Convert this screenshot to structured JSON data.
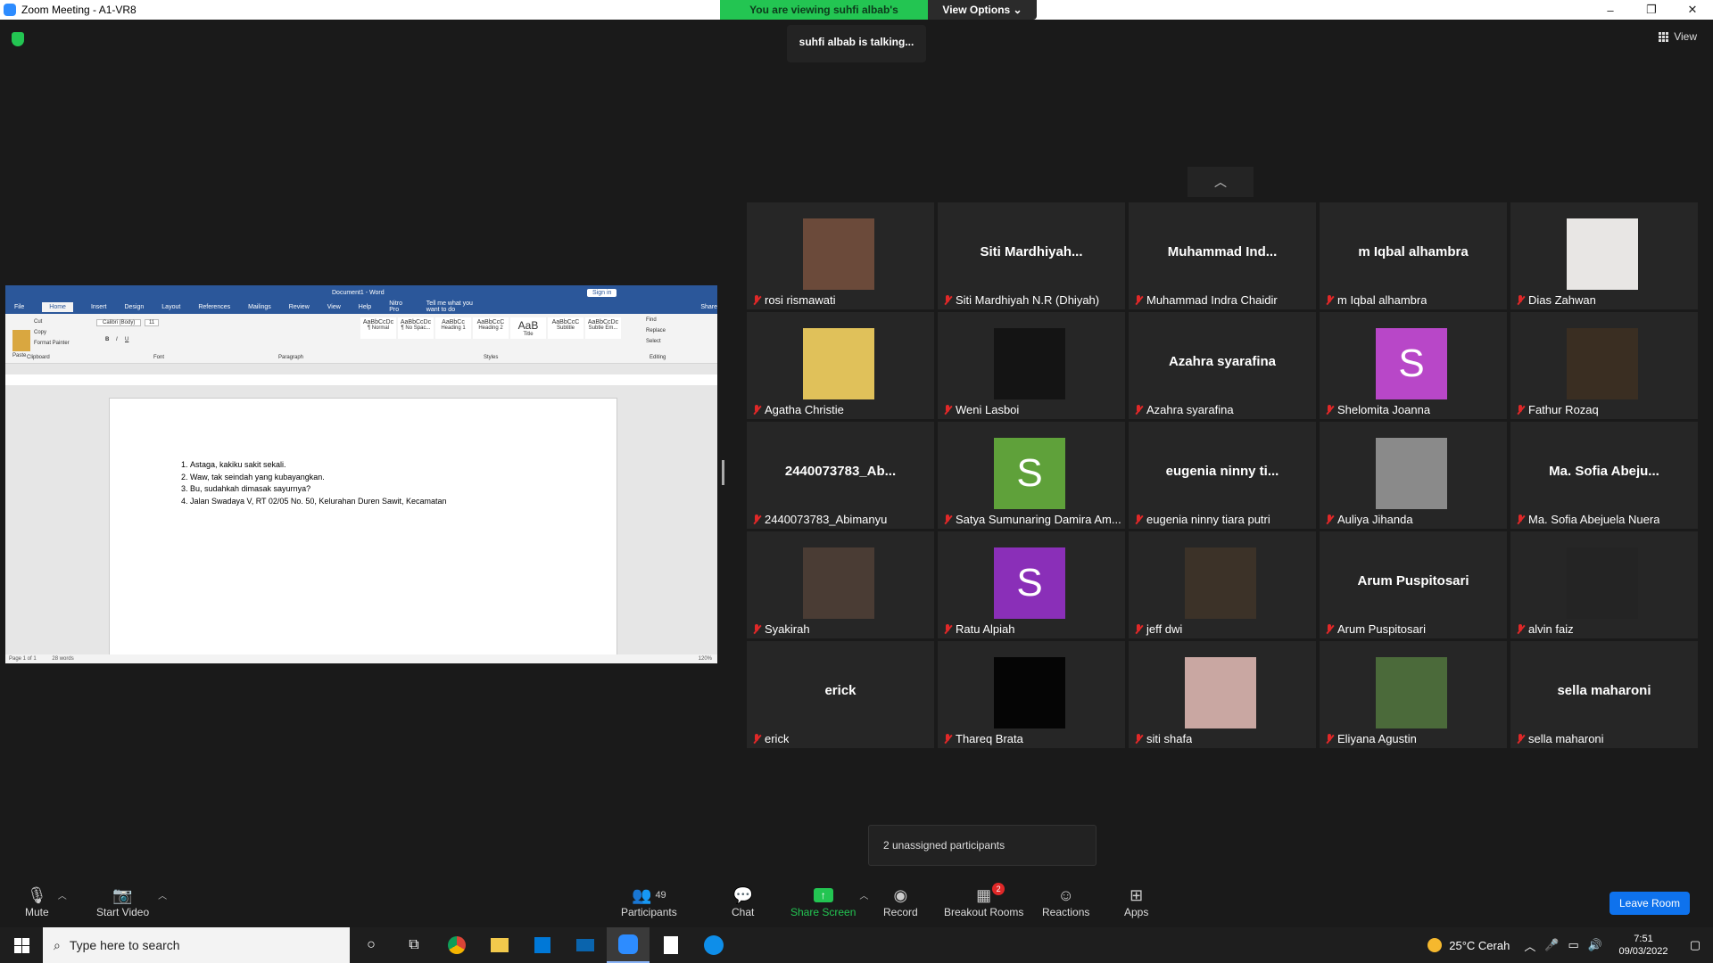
{
  "window": {
    "title": "Zoom Meeting - A1-VR8",
    "minimize": "–",
    "maximize": "❐",
    "close": "✕"
  },
  "share_banner": {
    "status": "You are viewing suhfi albab's screen",
    "view_options": "View Options ⌄"
  },
  "talking": "suhfi albab is talking...",
  "view_button": "View",
  "word": {
    "title": "Document1 - Word",
    "sign_in": "Sign in",
    "tabs": [
      "File",
      "Home",
      "Insert",
      "Design",
      "Layout",
      "References",
      "Mailings",
      "Review",
      "View",
      "Help",
      "Nitro Pro"
    ],
    "tell_me": "Tell me what you want to do",
    "share": "Share",
    "ribbon": {
      "paste": "Paste",
      "cut": "Cut",
      "copy": "Copy",
      "format_painter": "Format Painter",
      "clipboard": "Clipboard",
      "font_name": "Calibri (Body)",
      "font_size": "11",
      "font_group": "Font",
      "paragraph_group": "Paragraph",
      "styles": [
        "AaBbCcDc",
        "AaBbCcDc",
        "AaBbCc",
        "AaBbCcC",
        "AaB",
        "AaBbCcC",
        "AaBbCcDc"
      ],
      "style_names": [
        "¶ Normal",
        "¶ No Spac...",
        "Heading 1",
        "Heading 2",
        "Title",
        "Subtitle",
        "Subtle Em..."
      ],
      "styles_group": "Styles",
      "find": "Find",
      "replace": "Replace",
      "select": "Select",
      "editing_group": "Editing"
    },
    "list_items": [
      "Astaga, kakiku sakit sekali.",
      "Waw, tak seindah yang kubayangkan.",
      "Bu, sudahkah dimasak sayurnya?",
      "Jalan Swadaya V, RT 02/05 No. 50, Kelurahan Duren Sawit, Kecamatan"
    ],
    "status_page": "Page 1 of 1",
    "status_words": "28 words",
    "zoom": "120%"
  },
  "participants_grid": [
    {
      "name": "rosi rismawati",
      "video": "photo",
      "color": "#6b4a3a"
    },
    {
      "name": "Siti Mardhiyah N.R (Dhiyah)",
      "display": "Siti  Mardhiyah..."
    },
    {
      "name": "Muhammad Indra Chaidir",
      "display": "Muhammad  Ind..."
    },
    {
      "name": "m Iqbal alhambra",
      "display": "m Iqbal alhambra"
    },
    {
      "name": "Dias Zahwan",
      "video": "photo",
      "color": "#e8e6e4"
    },
    {
      "name": "Agatha Christie",
      "video": "photo",
      "color": "#e0c15a"
    },
    {
      "name": "Weni Lasboi",
      "video": "photo",
      "color": "#141414"
    },
    {
      "name": "Azahra syarafina",
      "display": "Azahra syarafina"
    },
    {
      "name": "Shelomita Joanna",
      "avatar": "S",
      "color": "#b847c8"
    },
    {
      "name": "Fathur Rozaq",
      "video": "photo",
      "color": "#3a2e22"
    },
    {
      "name": "2440073783_Abimanyu",
      "display": "2440073783_Ab..."
    },
    {
      "name": "Satya Sumunaring Damira Am...",
      "avatar": "S",
      "color": "#5fa13a"
    },
    {
      "name": "eugenia ninny tiara putri",
      "display": "eugenia  ninny  ti..."
    },
    {
      "name": "Auliya Jihanda",
      "video": "photo",
      "color": "#8a8a8a"
    },
    {
      "name": "Ma. Sofia Abejuela Nuera",
      "display": "Ma.  Sofia  Abeju..."
    },
    {
      "name": "Syakirah",
      "video": "photo",
      "color": "#4a3c34"
    },
    {
      "name": "Ratu Alpiah",
      "avatar": "S",
      "color": "#8a2fb8"
    },
    {
      "name": "jeff dwi",
      "video": "photo",
      "color": "#3c3228"
    },
    {
      "name": "Arum Puspitosari",
      "display": "Arum Puspitosari"
    },
    {
      "name": "alvin faiz",
      "video": "photo",
      "color": "#242424"
    },
    {
      "name": "erick",
      "display": "erick"
    },
    {
      "name": "Thareq Brata",
      "video": "photo",
      "color": "#050505"
    },
    {
      "name": "siti shafa",
      "video": "photo",
      "color": "#c9a7a2"
    },
    {
      "name": "Eliyana Agustin",
      "video": "photo",
      "color": "#4b6a3a"
    },
    {
      "name": "sella maharoni",
      "display": "sella maharoni"
    }
  ],
  "unassigned_popup": "2 unassigned participants",
  "toolbar": {
    "mute": "Mute",
    "start_video": "Start Video",
    "participants": "Participants",
    "participants_count": "49",
    "chat": "Chat",
    "share_screen": "Share Screen",
    "record": "Record",
    "breakout_rooms": "Breakout Rooms",
    "breakout_badge": "2",
    "reactions": "Reactions",
    "apps": "Apps",
    "leave_room": "Leave Room"
  },
  "taskbar": {
    "search_placeholder": "Type here to search",
    "weather": "25°C  Cerah",
    "time": "7:51",
    "date": "09/03/2022"
  }
}
